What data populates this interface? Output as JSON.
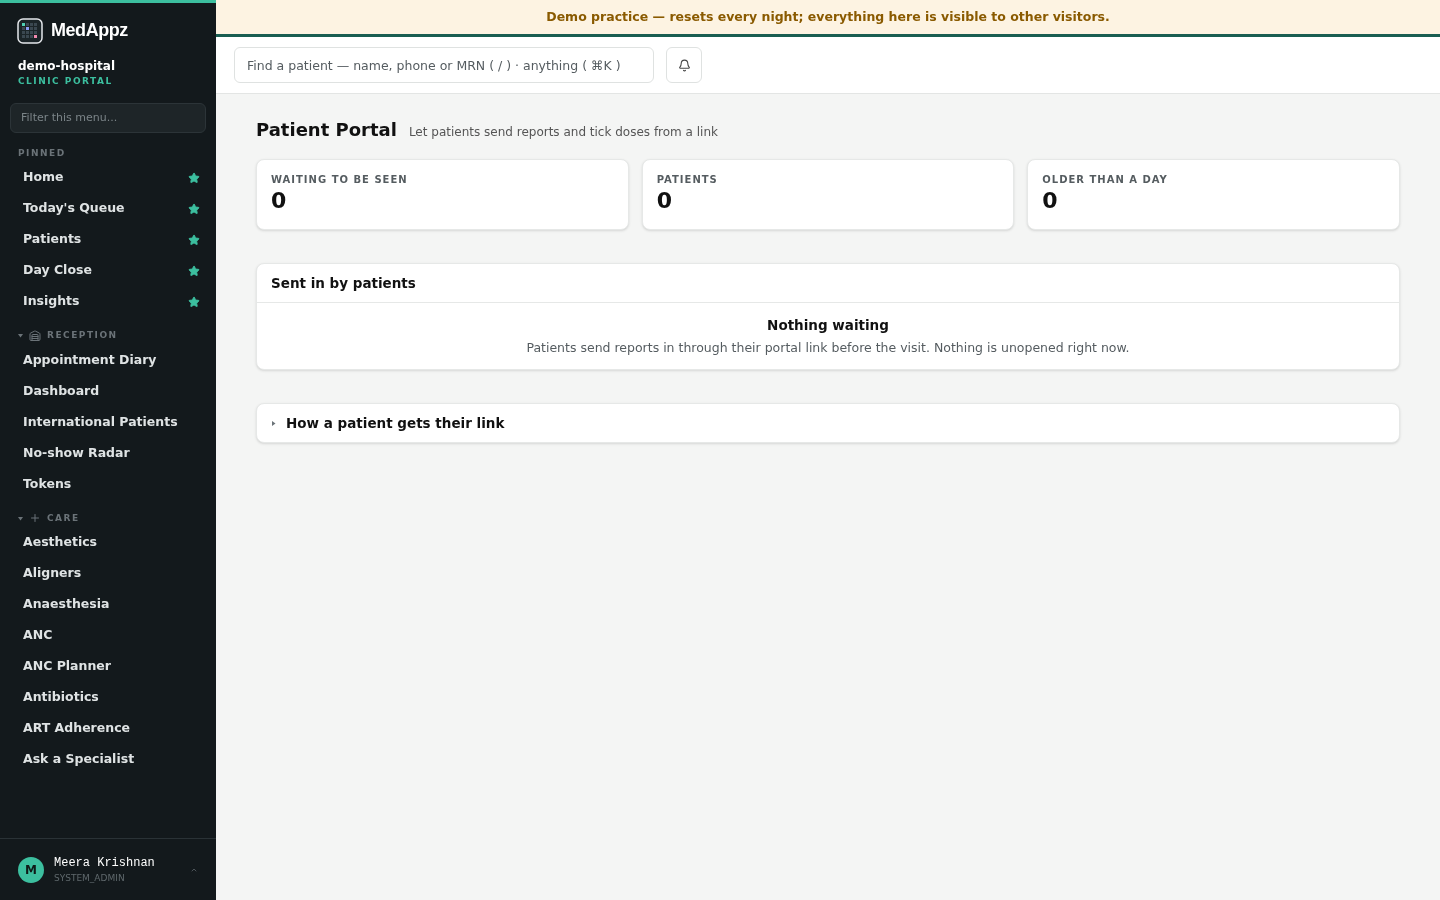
{
  "brand": {
    "name": "MedAppz",
    "org": "demo-hospital",
    "portal": "CLINIC PORTAL"
  },
  "sidebar": {
    "filter_placeholder": "Filter this menu...",
    "sections": [
      {
        "kind": "pinned",
        "title": "PINNED",
        "items": [
          {
            "label": "Home",
            "starred": true
          },
          {
            "label": "Today's Queue",
            "starred": true
          },
          {
            "label": "Patients",
            "starred": true
          },
          {
            "label": "Day Close",
            "starred": true
          },
          {
            "label": "Insights",
            "starred": true
          }
        ]
      },
      {
        "kind": "group",
        "title": "RECEPTION",
        "expanded": true,
        "items": [
          {
            "label": "Appointment Diary",
            "starred": false
          },
          {
            "label": "Dashboard",
            "starred": false
          },
          {
            "label": "International Patients",
            "starred": false
          },
          {
            "label": "No-show Radar",
            "starred": false
          },
          {
            "label": "Tokens",
            "starred": false
          }
        ]
      },
      {
        "kind": "group",
        "title": "CARE",
        "expanded": true,
        "items": [
          {
            "label": "Aesthetics",
            "starred": false
          },
          {
            "label": "Aligners",
            "starred": false
          },
          {
            "label": "Anaesthesia",
            "starred": false
          },
          {
            "label": "ANC",
            "starred": false
          },
          {
            "label": "ANC Planner",
            "starred": false
          },
          {
            "label": "Antibiotics",
            "starred": false
          },
          {
            "label": "ART Adherence",
            "starred": false
          },
          {
            "label": "Ask a Specialist",
            "starred": false
          }
        ]
      }
    ]
  },
  "user": {
    "initial": "M",
    "name": "Meera Krishnan",
    "role": "SYSTEM_ADMIN"
  },
  "banner": "Demo practice — resets every night; everything here is visible to other visitors.",
  "search": {
    "placeholder": "Find a patient — name, phone or MRN ( / ) · anything ( ⌘K )"
  },
  "page": {
    "title": "Patient Portal",
    "subtitle": "Let patients send reports and tick doses from a link"
  },
  "stats": [
    {
      "label": "WAITING TO BE SEEN",
      "value": "0"
    },
    {
      "label": "PATIENTS",
      "value": "0"
    },
    {
      "label": "OLDER THAN A DAY",
      "value": "0"
    }
  ],
  "inbox": {
    "title": "Sent in by patients",
    "empty_title": "Nothing waiting",
    "empty_text": "Patients send reports in through their portal link before the visit. Nothing is unopened right now."
  },
  "disclosure": {
    "title": "How a patient gets their link",
    "expanded": false
  }
}
